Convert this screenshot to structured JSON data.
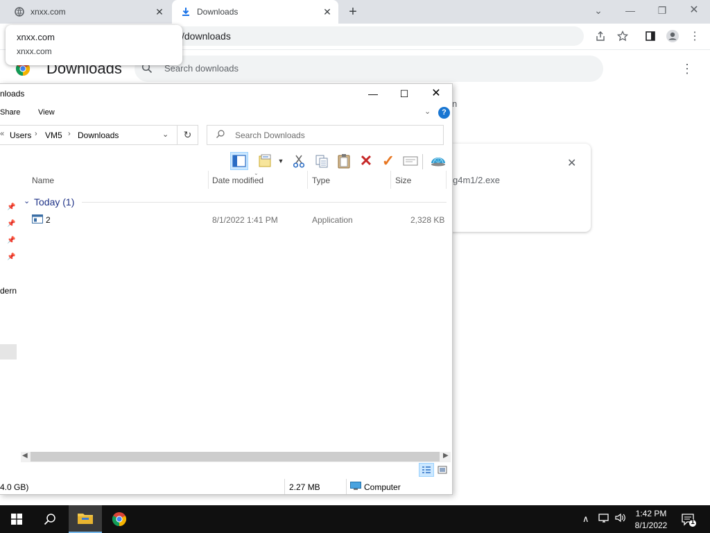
{
  "browser": {
    "tabs": [
      {
        "title": "xnxx.com",
        "icon": "globe-icon"
      },
      {
        "title": "Downloads",
        "icon": "download-icon",
        "active": true
      }
    ],
    "omnibox_text": "/downloads",
    "tooltip": {
      "line1": "xnxx.com",
      "line2": "xnxx.com"
    }
  },
  "downloads_page": {
    "title": "Downloads",
    "search_placeholder": "Search downloads",
    "heading_fragment": "n",
    "card_url_fragment": "g4m1/2.exe",
    "close_glyph": "✕"
  },
  "explorer": {
    "title_fragment": "nloads",
    "ribbon": {
      "share": "Share",
      "view": "View"
    },
    "breadcrumb": [
      "Users",
      "VM5",
      "Downloads"
    ],
    "breadcrumb_lead": "«",
    "search_placeholder": "Search Downloads",
    "columns": {
      "name": "Name",
      "date": "Date modified",
      "type": "Type",
      "size": "Size"
    },
    "group": "Today (1)",
    "files": [
      {
        "name": "2",
        "date": "8/1/2022 1:41 PM",
        "type": "Application",
        "size": "2,328 KB"
      }
    ],
    "nav_fragment": "dern",
    "status": {
      "free_fragment": "4.0 GB)",
      "selected_size": "2.27 MB",
      "location": "Computer"
    }
  },
  "taskbar": {
    "time": "1:42 PM",
    "date": "8/1/2022",
    "notification_count": "1"
  },
  "colors": {
    "taskbar_bg": "#101010",
    "chrome_frame": "#dee1e6",
    "accent_blue": "#1a73e8",
    "delete_red": "#c62828",
    "check_orange": "#e87722"
  }
}
